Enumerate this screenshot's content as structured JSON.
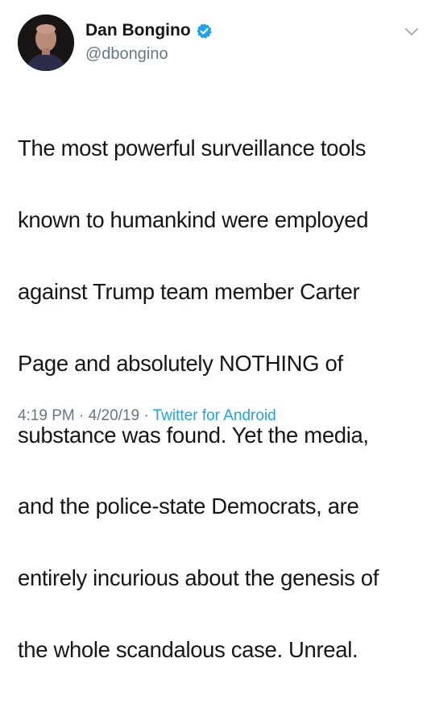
{
  "author": {
    "display_name": "Dan Bongino",
    "handle": "@dbongino",
    "verified": true,
    "avatar_icon": "avatar-photo"
  },
  "tweet": {
    "lines": [
      "The most powerful surveillance tools",
      "known to humankind were employed",
      "against Trump team member Carter",
      "Page and absolutely NOTHING of",
      "substance was found. Yet the media,",
      "and the police-state Democrats, are",
      "entirely incurious about the genesis of",
      "the whole scandalous case. Unreal."
    ]
  },
  "meta": {
    "time": "4:19 PM",
    "separator": "·",
    "date": "4/20/19",
    "source": "Twitter for Android"
  },
  "colors": {
    "text": "#14171a",
    "muted": "#657786",
    "link": "#1da1f2",
    "verified": "#1da1f2"
  }
}
